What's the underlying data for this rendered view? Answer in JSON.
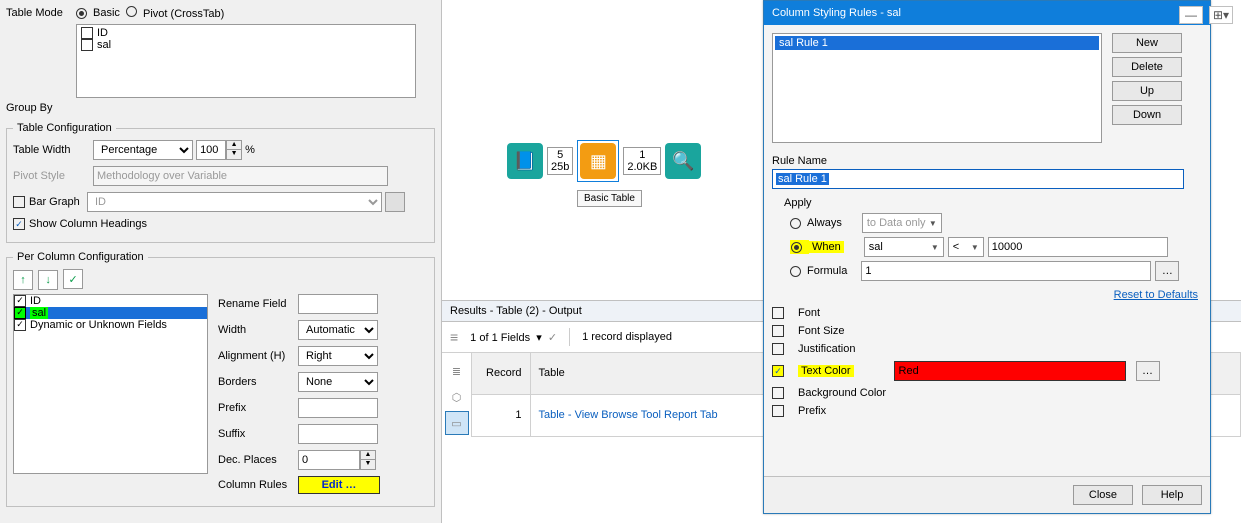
{
  "leftpanel": {
    "table_mode_label": "Table Mode",
    "basic_label": "Basic",
    "pivot_label": "Pivot (CrossTab)",
    "fields": [
      "ID",
      "sal"
    ],
    "group_by_label": "Group By",
    "table_config_legend": "Table Configuration",
    "table_width_label": "Table Width",
    "table_width_combo": "Percentage",
    "table_width_value": "100",
    "percent_sign": "%",
    "pivot_style_label": "Pivot Style",
    "pivot_style_value": "Methodology over Variable",
    "bar_graph_label": "Bar Graph",
    "bar_graph_combo": "ID",
    "show_col_label": "Show Column Headings",
    "per_column_legend": "Per Column Configuration",
    "col_items": [
      "ID",
      "sal",
      "Dynamic or Unknown Fields"
    ],
    "rename_label": "Rename Field",
    "rename_value": "",
    "width_label": "Width",
    "width_combo": "Automatic",
    "align_label": "Alignment (H)",
    "align_combo": "Right",
    "borders_label": "Borders",
    "borders_combo": "None",
    "prefix_label": "Prefix",
    "prefix_value": "",
    "suffix_label": "Suffix",
    "suffix_value": "",
    "dec_label": "Dec. Places",
    "dec_value": "0",
    "col_rules_label": "Column Rules",
    "edit_btn": "Edit …"
  },
  "canvas": {
    "conn1_top": "5",
    "conn1_bot": "25b",
    "conn2_top": "1",
    "conn2_bot": "2.0KB",
    "basic_table_label": "Basic Table"
  },
  "results": {
    "header": "Results - Table (2) - Output",
    "fields_text": "1 of 1 Fields",
    "records_text": "1 record displayed",
    "col_record": "Record",
    "col_table": "Table",
    "row1_rec": "1",
    "row1_table": "Table - View Browse Tool Report Tab"
  },
  "dialog": {
    "title": "Column Styling Rules - sal",
    "rule_item": "sal Rule 1",
    "new_btn": "New",
    "delete_btn": "Delete",
    "up_btn": "Up",
    "down_btn": "Down",
    "rule_name_label": "Rule Name",
    "rule_name_value": "sal Rule 1",
    "apply_label": "Apply",
    "always_label": "Always",
    "to_data_label": "to Data only",
    "when_label": "When",
    "when_field": "sal",
    "when_op": "<",
    "when_value": "10000",
    "formula_label": "Formula",
    "formula_value": "1",
    "reset_link": "Reset to Defaults",
    "font_label": "Font",
    "fontsize_label": "Font Size",
    "just_label": "Justification",
    "textcolor_label": "Text Color",
    "textcolor_value": "Red",
    "bgcolor_label": "Background Color",
    "prefix_label": "Prefix",
    "close_btn": "Close",
    "help_btn": "Help"
  }
}
